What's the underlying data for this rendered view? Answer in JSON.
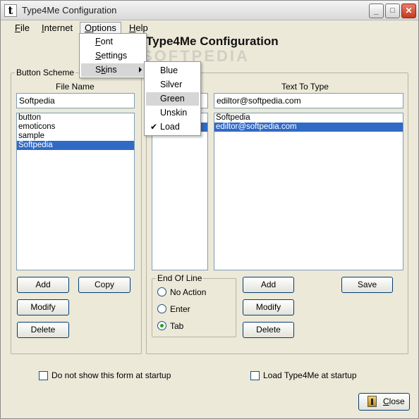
{
  "window": {
    "title": "Type4Me Configuration",
    "controls": {
      "minimize": "_",
      "maximize": "□",
      "close": "✕"
    }
  },
  "menubar": {
    "items": [
      {
        "pre": "",
        "acc": "F",
        "post": "ile"
      },
      {
        "pre": "",
        "acc": "I",
        "post": "nternet"
      },
      {
        "pre": "",
        "acc": "O",
        "post": "ptions"
      },
      {
        "pre": "",
        "acc": "H",
        "post": "elp"
      }
    ]
  },
  "options_menu": {
    "items": [
      {
        "pre": "",
        "acc": "F",
        "post": "ont"
      },
      {
        "pre": "",
        "acc": "S",
        "post": "ettings"
      },
      {
        "pre": "S",
        "acc": "k",
        "post": "ins"
      }
    ]
  },
  "skins_menu": {
    "items": [
      "Blue",
      "Silver",
      "Green",
      "Unskin",
      "Load"
    ],
    "highlighted": "Green",
    "checked": "Load",
    "check_glyph": "✔"
  },
  "main": {
    "heading": "Type4Me Configuration",
    "watermark": "SOFTPEDIA",
    "button_scheme": {
      "group_label": "Button Scheme",
      "file_name_label": "File Name",
      "file_name_value": "Softpedia",
      "files": [
        "button",
        "emoticons",
        "sample",
        "Softpedia"
      ],
      "selected_file": "Softpedia",
      "buttons": {
        "add": "Add",
        "copy": "Copy",
        "modify": "Modify",
        "delete": "Delete"
      }
    },
    "buttons_panel": {
      "text_to_type_label": "Text To Type",
      "text_value": "ediltor@softpedia.com",
      "items": [
        "Softpedia",
        "ediltor@softpedia.com"
      ],
      "selected": "ediltor@softpedia.com",
      "end_of_line": {
        "label": "End Of Line",
        "options": [
          "No Action",
          "Enter",
          "Tab"
        ],
        "selected": "Tab"
      },
      "buttons": {
        "add": "Add",
        "modify": "Modify",
        "delete": "Delete",
        "save": "Save"
      }
    },
    "options": {
      "do_not_show": "Do not show this form at startup",
      "load_at_startup": "Load Type4Me at startup"
    },
    "close_button": {
      "pre": "",
      "acc": "C",
      "post": "lose"
    }
  },
  "colors": {
    "selection": "#316ac5",
    "window_bg": "#ece9d8",
    "radio_dot": "#21a121"
  }
}
